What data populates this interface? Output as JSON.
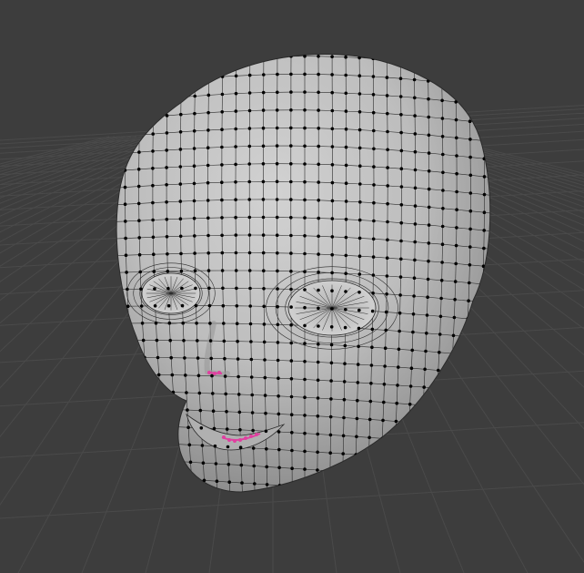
{
  "viewport": {
    "background": "#3d3d3d",
    "grid_color": "#4a4a4a",
    "grid_major_color": "#525252"
  },
  "mesh": {
    "object": "head",
    "mode": "edit",
    "surface_color": "#c4c4c4",
    "wire_color": "#2a2a2a",
    "vertex_color": "#000000",
    "selected_vertex_color": "#e040a0",
    "selected_region": [
      "nostril",
      "mouth-corner"
    ]
  }
}
